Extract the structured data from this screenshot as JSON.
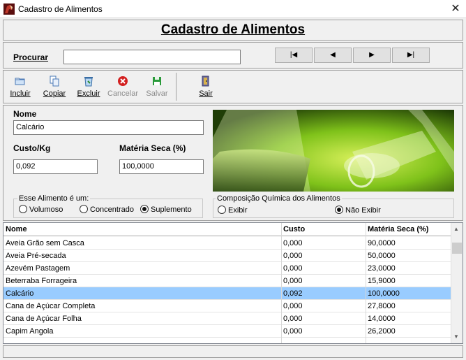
{
  "window": {
    "title": "Cadastro de Alimentos"
  },
  "header": {
    "title": "Cadastro de Alimentos"
  },
  "search": {
    "label": "Procurar",
    "value": ""
  },
  "nav": {
    "first": "|◀",
    "prev": "◀",
    "next": "▶",
    "last": "▶|"
  },
  "toolbar": {
    "incluir": "Incluir",
    "copiar": "Copiar",
    "excluir": "Excluir",
    "cancelar": "Cancelar",
    "salvar": "Salvar",
    "sair": "Sair"
  },
  "form": {
    "nome_label": "Nome",
    "nome_value": "Calcário",
    "custo_label": "Custo/Kg",
    "custo_value": "0,092",
    "materia_label": "Matéria Seca (%)",
    "materia_value": "100,0000"
  },
  "tipo": {
    "legend": "Esse Alimento é um:",
    "options": [
      "Volumoso",
      "Concentrado",
      "Suplemento"
    ],
    "selected": "Suplemento"
  },
  "composicao": {
    "legend": "Composição Química dos Alimentos",
    "options": [
      "Exibir",
      "Não Exibir"
    ],
    "selected": "Não Exibir"
  },
  "table": {
    "headers": [
      "Nome",
      "Custo",
      "Matéria Seca (%)"
    ],
    "rows": [
      [
        "Aveia Grão sem Casca",
        "0,000",
        "90,0000"
      ],
      [
        "Aveia Pré-secada",
        "0,000",
        "50,0000"
      ],
      [
        "Azevém Pastagem",
        "0,000",
        "23,0000"
      ],
      [
        "Beterraba Forrageira",
        "0,000",
        "15,9000"
      ],
      [
        "Calcário",
        "0,092",
        "100,0000"
      ],
      [
        "Cana de Açúcar Completa",
        "0,000",
        "27,8000"
      ],
      [
        "Cana de Açúcar Folha",
        "0,000",
        "14,0000"
      ],
      [
        "Capim Angola",
        "0,000",
        "26,2000"
      ]
    ],
    "selected_index": 4
  },
  "colors": {
    "selection": "#99ccff",
    "accent": "#cc0000"
  }
}
